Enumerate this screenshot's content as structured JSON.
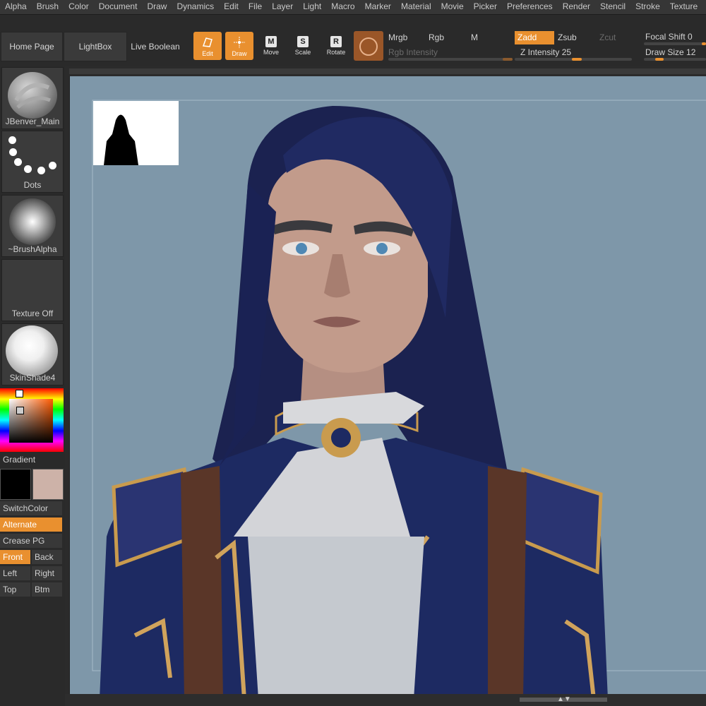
{
  "menu": [
    "Alpha",
    "Brush",
    "Color",
    "Document",
    "Draw",
    "Dynamics",
    "Edit",
    "File",
    "Layer",
    "Light",
    "Macro",
    "Marker",
    "Material",
    "Movie",
    "Picker",
    "Preferences",
    "Render",
    "Stencil",
    "Stroke",
    "Texture"
  ],
  "shelf": {
    "home_page": "Home Page",
    "lightbox": "LightBox",
    "live_boolean": "Live Boolean",
    "tools": {
      "edit": "Edit",
      "draw": "Draw",
      "move": "Move",
      "scale": "Scale",
      "rotate": "Rotate"
    },
    "tool_keys": {
      "move": "M",
      "scale": "S",
      "rotate": "R"
    },
    "mrgb": "Mrgb",
    "rgb": "Rgb",
    "m": "M",
    "rgb_intensity": "Rgb Intensity",
    "zadd": "Zadd",
    "zsub": "Zsub",
    "zcut": "Zcut",
    "z_intensity_label": "Z Intensity",
    "z_intensity_value": "25",
    "focal_shift_label": "Focal Shift",
    "focal_shift_value": "0",
    "draw_size_label": "Draw Size",
    "draw_size_value": "12"
  },
  "tray": {
    "brush_name": "JBenver_Main",
    "stroke_name": "Dots",
    "alpha_name": "~BrushAlpha",
    "texture_name": "Texture Off",
    "material_name": "SkinShade4",
    "gradient": "Gradient",
    "switch_color": "SwitchColor",
    "alternate": "Alternate",
    "crease_pg": "Crease PG",
    "front": "Front",
    "back": "Back",
    "left": "Left",
    "right": "Right",
    "top": "Top",
    "btm": "Btm"
  },
  "colors": {
    "accent": "#e9902f",
    "canvas_bg": "#7e97a9",
    "primary_color": "#000000",
    "secondary_color": "#cdb2a8"
  },
  "icons": [
    "edit-icon",
    "draw-icon",
    "move-icon",
    "scale-icon",
    "rotate-icon",
    "material-icon",
    "nav-arrows-icon"
  ]
}
